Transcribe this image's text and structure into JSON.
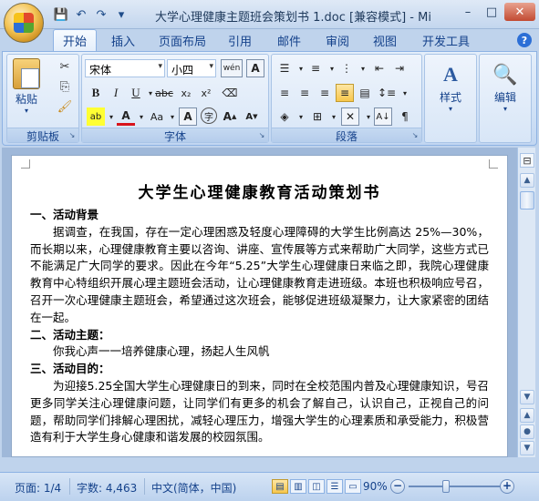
{
  "window": {
    "title": "大学心理健康主题班会策划书 1.doc [兼容模式] - Mi",
    "buttons": {
      "minimize": "–",
      "maximize": "□",
      "close": "✕"
    }
  },
  "qat": {
    "save": "💾",
    "undo": "↶",
    "redo": "↷",
    "customize": "▾"
  },
  "tabs": [
    "开始",
    "插入",
    "页面布局",
    "引用",
    "邮件",
    "审阅",
    "视图",
    "开发工具"
  ],
  "active_tab": "开始",
  "help": "?",
  "ribbon": {
    "clipboard": {
      "label": "剪贴板",
      "paste": "粘贴"
    },
    "font": {
      "label": "字体",
      "font_name": "宋体",
      "font_size": "小四",
      "wen_label": "wén",
      "char_border": "A",
      "size_up": "A",
      "size_down": "A"
    },
    "paragraph": {
      "label": "段落"
    },
    "styles": {
      "label": "样式",
      "icon": "A"
    },
    "editing": {
      "label": "编辑",
      "icon": "A"
    }
  },
  "document": {
    "title": "大学生心理健康教育活动策划书",
    "paragraphs": [
      {
        "type": "h",
        "text": "一、活动背景"
      },
      {
        "type": "p",
        "text": "据调查，在我国，存在一定心理困惑及轻度心理障碍的大学生比例高达 25%—30%，而长期以来，心理健康教育主要以咨询、讲座、宣传展等方式来帮助广大同学，这些方式已不能满足广大同学的要求。因此在今年“5.25”大学生心理健康日来临之即，我院心理健康教育中心特组织开展心理主题班会活动，让心理健康教育走进班级。本班也积极响应号召，召开一次心理健康主题班会，希望通过这次班会，能够促进班级凝聚力，让大家紧密的团结在一起。"
      },
      {
        "type": "h",
        "text": "二、活动主题："
      },
      {
        "type": "p",
        "text": "你我心声一一培养健康心理，扬起人生风帆"
      },
      {
        "type": "h",
        "text": "三、活动目的："
      },
      {
        "type": "p",
        "text": "为迎接5.25全国大学生心理健康日的到来，同时在全校范围内普及心理健康知识，号召更多同学关注心理健康问题，让同学们有更多的机会了解自己，认识自己，正视自己的问题，帮助同学们排解心理困扰，减轻心理压力，增强大学生的心理素质和承受能力，积极营造有利于大学生身心健康和谐发展的校园氛围。"
      }
    ]
  },
  "status": {
    "page": "页面: 1/4",
    "words": "字数: 4,463",
    "language": "中文(简体，中国)",
    "zoom": "90%",
    "zoom_minus": "−",
    "zoom_plus": "+"
  }
}
